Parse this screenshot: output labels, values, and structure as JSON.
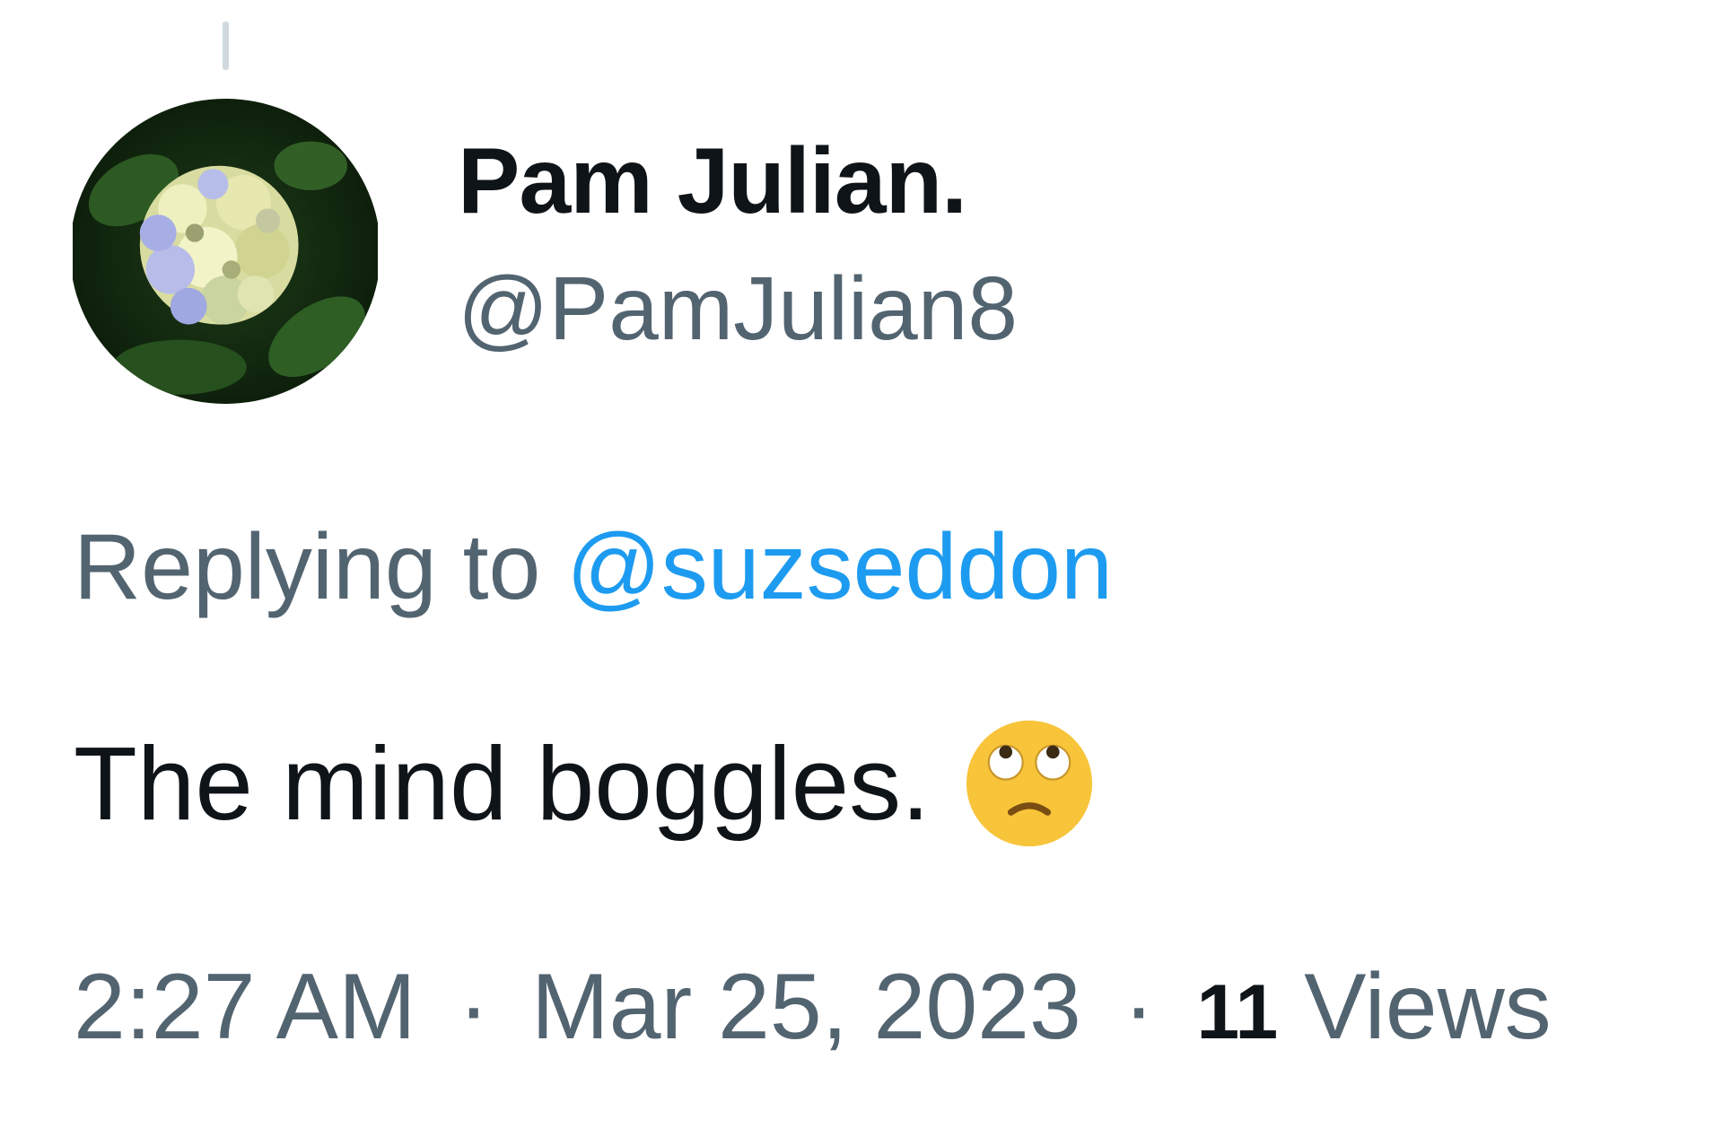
{
  "tweet": {
    "author": {
      "display_name": "Pam Julian.",
      "handle": "@PamJulian8",
      "avatar_icon": "hydrangea-avatar"
    },
    "reply": {
      "prefix": "Replying to",
      "mention": "@suzseddon"
    },
    "text": "The mind boggles.",
    "emoji": "face-with-rolling-eyes-icon",
    "meta": {
      "time": "2:27 AM",
      "date": "Mar 25, 2023",
      "separator": "·",
      "views_count": "11",
      "views_label": "Views"
    },
    "colors": {
      "primary_text": "#0f1419",
      "secondary_text": "#536471",
      "link": "#1d9bf0"
    }
  }
}
